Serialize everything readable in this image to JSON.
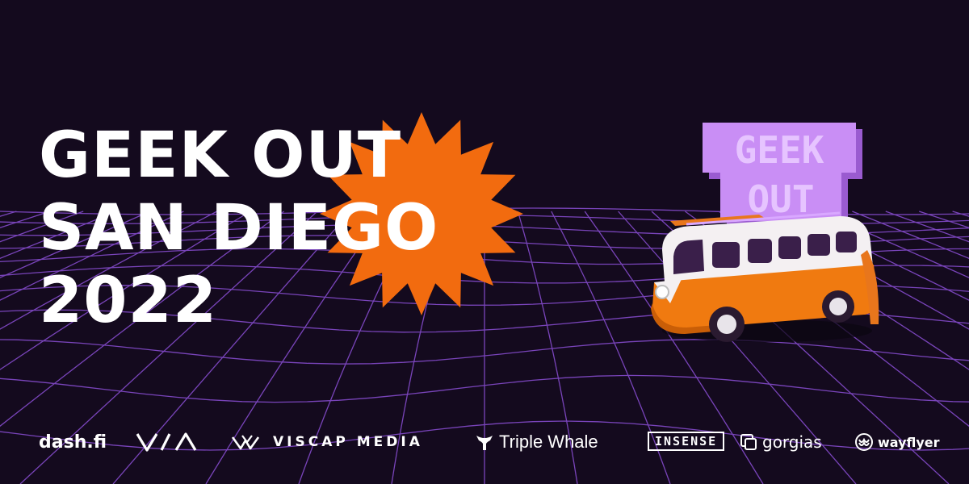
{
  "headline": {
    "line1": "GEEK OUT",
    "line2": "SAN DIEGO",
    "line3": "2022"
  },
  "badge": {
    "line1": "GEEK",
    "line2": "OUT"
  },
  "sponsors": {
    "dash": "dash.fi",
    "viscap": "VISCAP MEDIA",
    "triple_whale": "Triple Whale",
    "insense": "INSENSE",
    "gorgias": "gorgias",
    "wayflyer": "wayflyer"
  },
  "colors": {
    "background": "#140a1e",
    "grid": "#8b4fd6",
    "starburst": "#f26b0f",
    "badge": "#c98ef5",
    "text": "#ffffff"
  }
}
